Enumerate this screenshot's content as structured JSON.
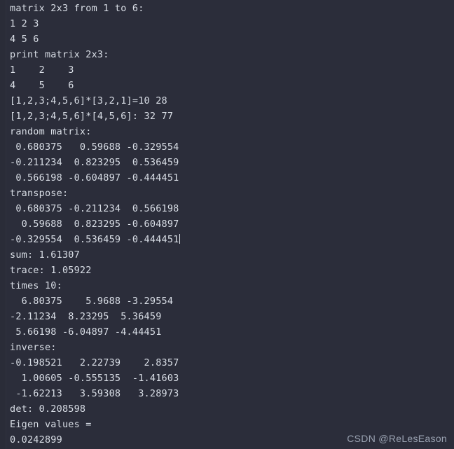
{
  "terminal": {
    "background_color": "#2b2d3a",
    "text_color": "#d9dee6",
    "caret_after_line_index": 15,
    "lines": [
      "matrix 2x3 from 1 to 6:",
      "1 2 3",
      "4 5 6",
      "print matrix 2x3:",
      "1    2    3",
      "4    5    6",
      "[1,2,3;4,5,6]*[3,2,1]=10 28",
      "[1,2,3;4,5,6]*[4,5,6]: 32 77",
      "random matrix:",
      " 0.680375   0.59688 -0.329554",
      "-0.211234  0.823295  0.536459",
      " 0.566198 -0.604897 -0.444451",
      "transpose:",
      " 0.680375 -0.211234  0.566198",
      "  0.59688  0.823295 -0.604897",
      "-0.329554  0.536459 -0.444451",
      "sum: 1.61307",
      "trace: 1.05922",
      "times 10:",
      "  6.80375    5.9688 -3.29554",
      "-2.11234  8.23295  5.36459",
      " 5.66198 -6.04897 -4.44451",
      "inverse:",
      "-0.198521   2.22739    2.8357",
      "  1.00605 -0.555135  -1.41603",
      " -1.62213   3.59308   3.28973",
      "det: 0.208598",
      "Eigen values =",
      "0.0242899"
    ]
  },
  "watermark": {
    "text": "CSDN @ReLesEason"
  }
}
